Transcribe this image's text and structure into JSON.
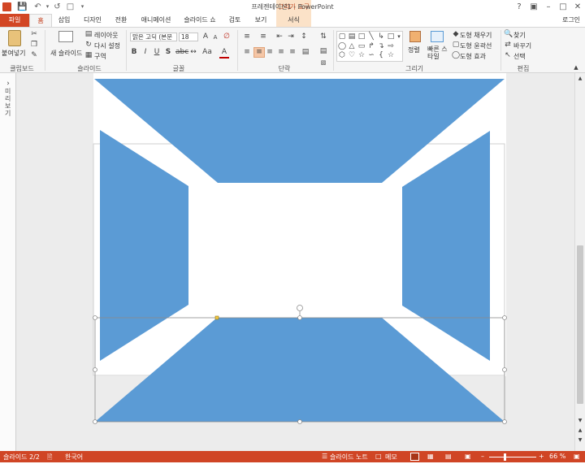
{
  "window": {
    "title": "프레젠테이션1 - PowerPoint",
    "contextual_tab_group": "그리기 도구",
    "sign_in": "로그인"
  },
  "tabs": [
    {
      "label": "파일"
    },
    {
      "label": "홈"
    },
    {
      "label": "삽입"
    },
    {
      "label": "디자인"
    },
    {
      "label": "전환"
    },
    {
      "label": "애니메이션"
    },
    {
      "label": "슬라이드 쇼"
    },
    {
      "label": "검토"
    },
    {
      "label": "보기"
    },
    {
      "label": "서식"
    }
  ],
  "ribbon": {
    "clipboard": {
      "paste_label": "붙여넣기",
      "group_label": "클립보드"
    },
    "slides": {
      "new_slide_label": "새 슬라이드",
      "layout_label": "레이아웃",
      "reset_label": "다시 설정",
      "section_label": "구역",
      "group_label": "슬라이드"
    },
    "font": {
      "font_name": "맑은 고딕 (본문",
      "font_size": "18",
      "group_label": "글꼴"
    },
    "paragraph": {
      "group_label": "단락"
    },
    "drawing": {
      "arrange_label": "정렬",
      "quick_styles_label": "빠른 스타일",
      "shape_fill_label": "도형 채우기",
      "shape_outline_label": "도형 윤곽선",
      "shape_effects_label": "도형 효과",
      "group_label": "그리기"
    },
    "editing": {
      "find_label": "찾기",
      "replace_label": "바꾸기",
      "select_label": "선택",
      "group_label": "편집"
    }
  },
  "thumbnail_pane": {
    "collapsed_label": "미리 보기"
  },
  "status": {
    "slide_indicator": "슬라이드 2/2",
    "language": "한국어",
    "notes_label": "슬라이드 노트",
    "comments_label": "메모",
    "zoom": "66 %"
  },
  "colors": {
    "shape_fill": "#5b9bd5",
    "accent": "#d24625"
  }
}
